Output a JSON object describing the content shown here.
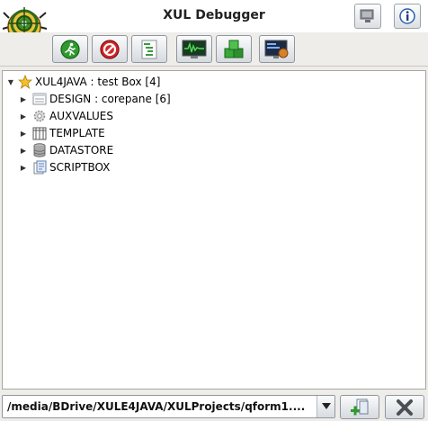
{
  "window": {
    "title": "XUL Debugger"
  },
  "toolbar": {
    "buttons": [
      {
        "name": "run",
        "icon": "running-man-icon"
      },
      {
        "name": "stop",
        "icon": "stop-icon"
      },
      {
        "name": "step-list",
        "icon": "step-list-icon"
      },
      {
        "name": "monitor",
        "icon": "waveform-monitor-icon"
      },
      {
        "name": "components",
        "icon": "green-blocks-icon"
      },
      {
        "name": "console",
        "icon": "console-monitor-icon"
      }
    ]
  },
  "tree": {
    "root": {
      "label": "XUL4JAVA : test Box [4]",
      "icon": "star-icon",
      "expanded": true
    },
    "children": [
      {
        "label": "DESIGN : corepane [6]",
        "icon": "panel-icon"
      },
      {
        "label": "AUXVALUES",
        "icon": "gear-icon"
      },
      {
        "label": "TEMPLATE",
        "icon": "template-icon"
      },
      {
        "label": "DATASTORE",
        "icon": "database-icon"
      },
      {
        "label": "SCRIPTBOX",
        "icon": "script-icon"
      }
    ]
  },
  "path": {
    "value": "/media/BDrive/XULE4JAVA/XULProjects/qform1...."
  },
  "colors": {
    "accent_green": "#2f8f2f",
    "stop_red": "#cc2222",
    "background": "#eeedea"
  }
}
